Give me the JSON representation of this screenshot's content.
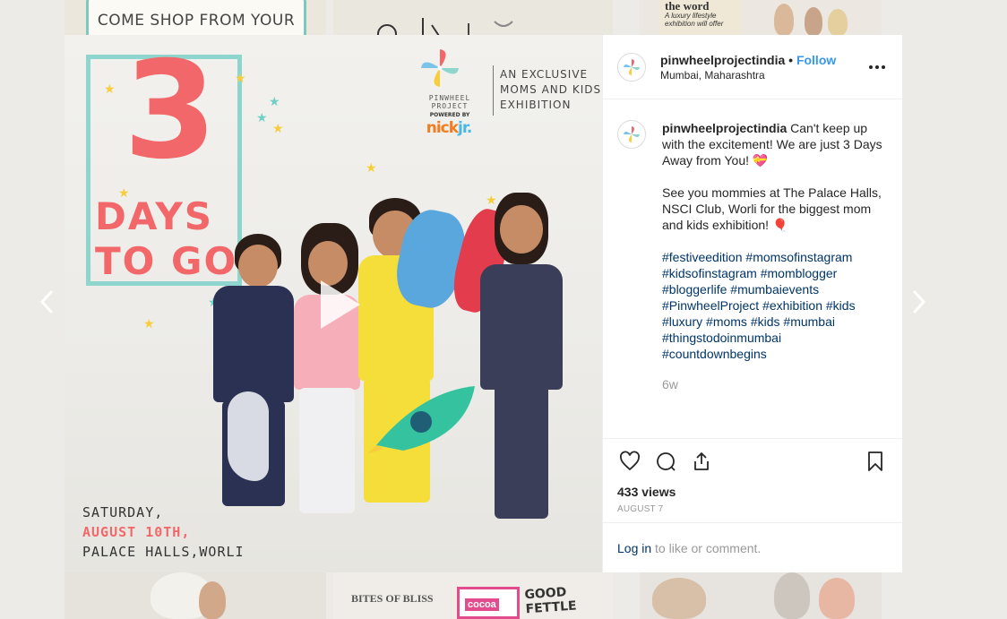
{
  "background": {
    "tile_top_left_sign": "COME SHOP FROM YOUR",
    "tile_top_right_headline": "the word",
    "tile_top_right_sub": "A luxury lifestyle exhibition will offer",
    "tile_bottom_middle_text": "GOOD FETTLE",
    "tile_bottom_middle_brand": "BITES OF BLISS",
    "tile_bottom_middle_badge": "cocoa"
  },
  "navigation": {
    "prev_icon": "chevron-left-icon",
    "next_icon": "chevron-right-icon"
  },
  "media": {
    "countdown_number": "3",
    "countdown_line1": "DAYS",
    "countdown_line2": "TO GO",
    "brand_name_line1": "PINWHEEL",
    "brand_name_line2": "PROJECT",
    "tagline_line1": "AN EXCLUSIVE",
    "tagline_line2": "MOMS AND KIDS",
    "tagline_line3": "EXHIBITION",
    "powered_by": "POWERED BY",
    "sponsor_part1": "nick",
    "sponsor_part2": "jr.",
    "event_day": "SATURDAY,",
    "event_date": "AUGUST 10TH,",
    "event_venue": "PALACE HALLS,WORLI",
    "play_icon": "play-icon"
  },
  "post": {
    "username": "pinwheelprojectindia",
    "separator": "•",
    "follow_label": "Follow",
    "location": "Mumbai, Maharashtra",
    "more_icon": "more-options-icon",
    "caption_line1": "Can't keep up with the excitement! We are just 3 Days Away from You! 💝",
    "caption_line2": "See you mommies at The Palace Halls, NSCI Club, Worli for the biggest mom and kids exhibition! 🎈",
    "hashtags": [
      "#festiveedition",
      "#momsofinstagram",
      "#kidsofinstagram",
      "#momblogger",
      "#bloggerlife",
      "#mumbaievents",
      "#PinwheelProject",
      "#exhibition",
      "#kids",
      "#luxury",
      "#moms",
      "#kids",
      "#mumbai",
      "#thingstodoinmumbai",
      "#countdownbegins"
    ],
    "time_ago": "6w",
    "views": "433 views",
    "date": "AUGUST 7",
    "login_link": "Log in",
    "login_suffix": " to like or comment."
  },
  "colors": {
    "accent_coral": "#f2686a",
    "accent_teal": "#8ed6cd",
    "link_blue": "#3897f0",
    "hashtag_navy": "#003569"
  }
}
